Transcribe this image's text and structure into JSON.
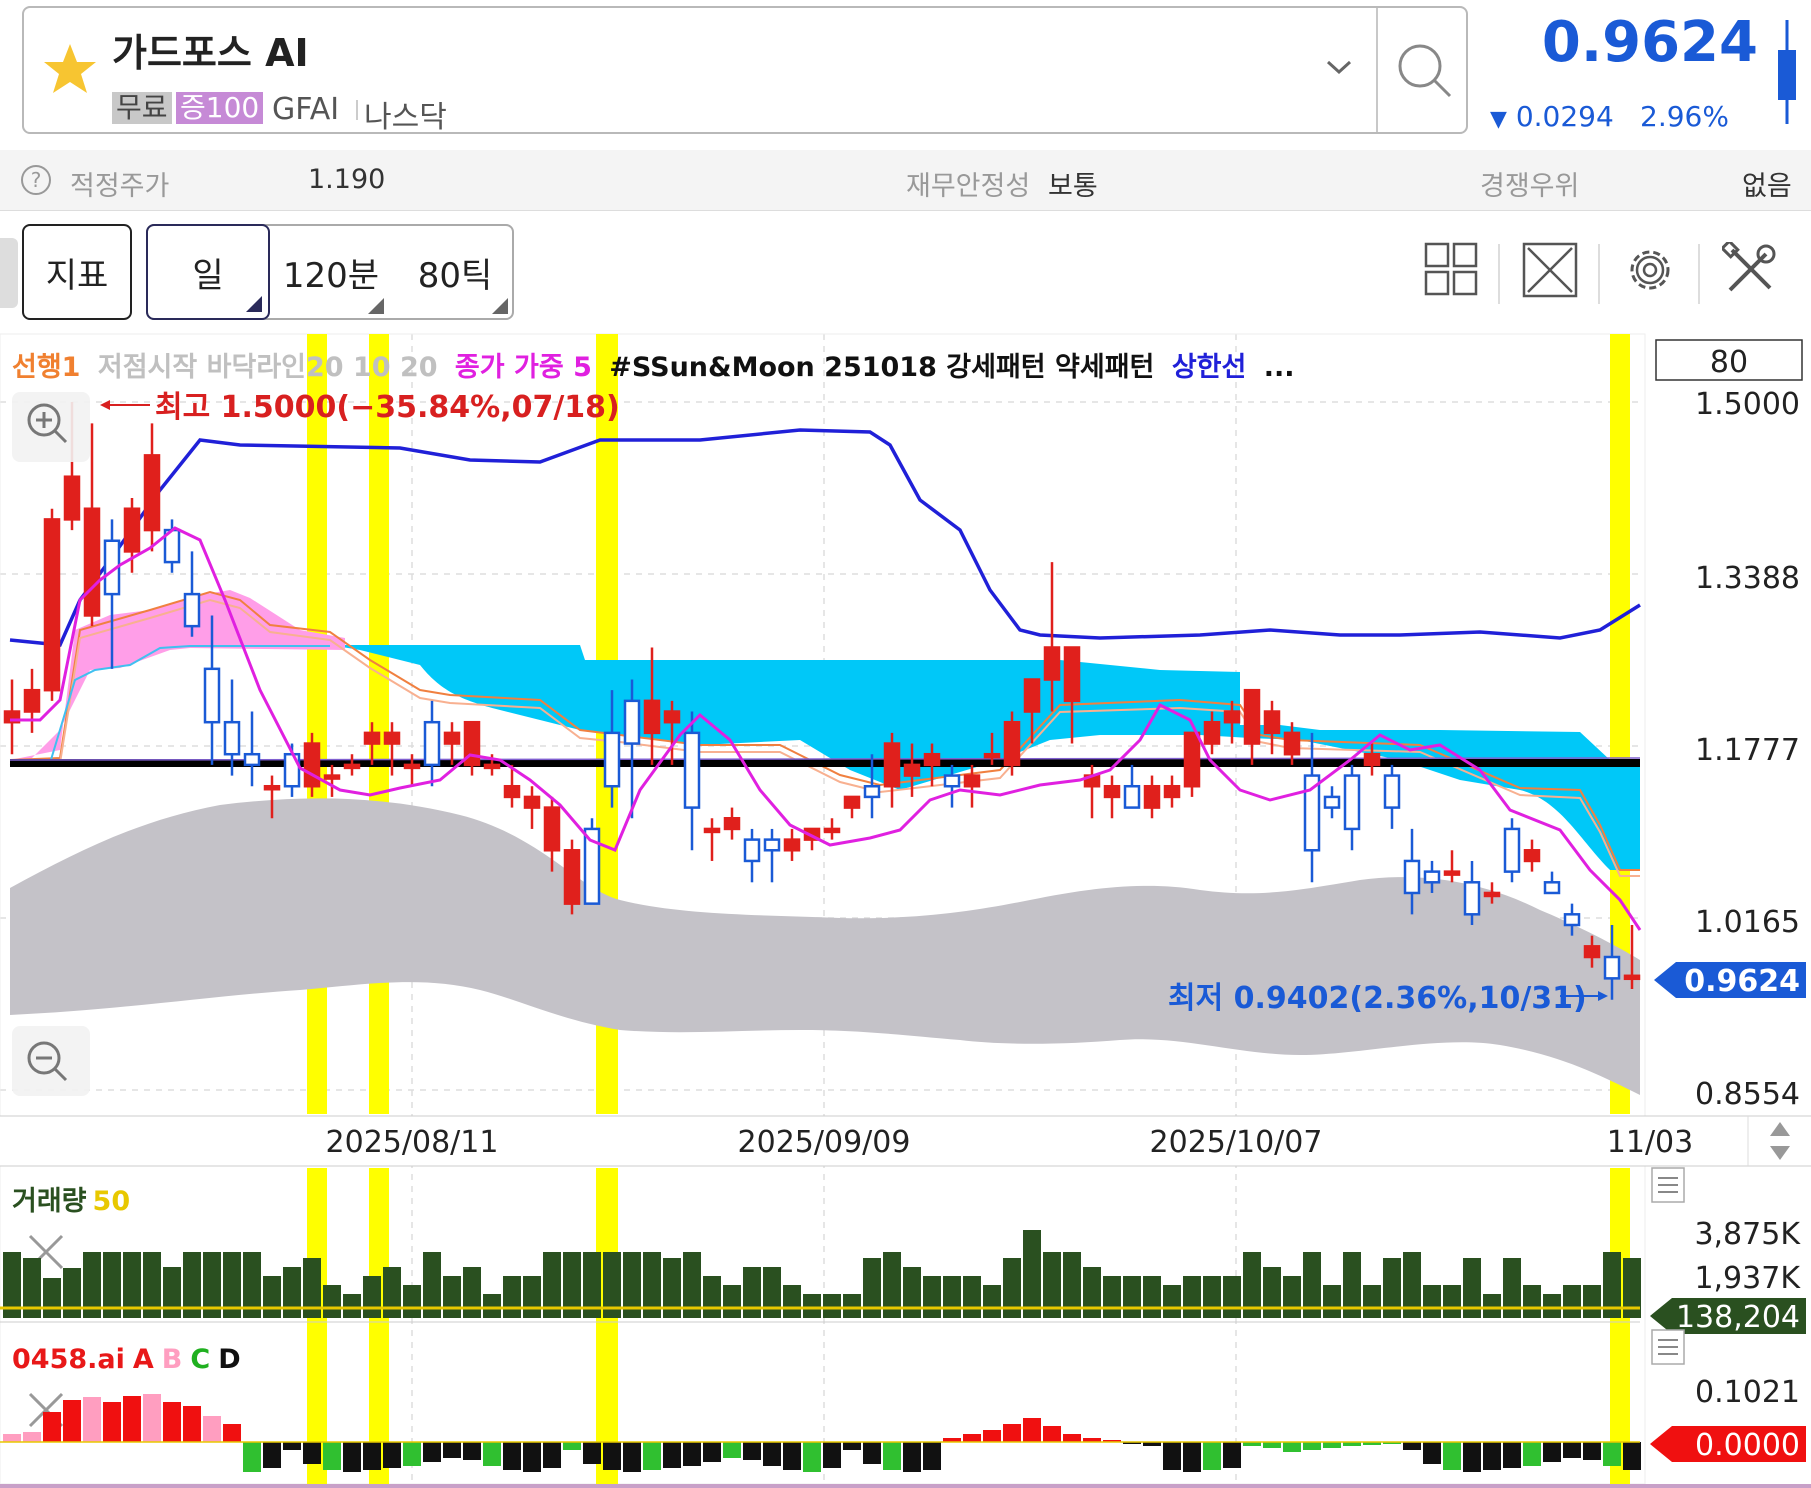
{
  "header": {
    "stock_name": "가드포스 AI",
    "tag_free": "무료",
    "tag_margin": "증100",
    "ticker": "GFAI",
    "market": "나스닥",
    "price": "0.9624",
    "change": "0.0294",
    "change_pct": "2.96%",
    "colors": {
      "down": "#1a5ad6",
      "up": "#e0201c"
    }
  },
  "info": {
    "fair_value_label": "적정주가",
    "fair_value": "1.190",
    "stability_label": "재무안정성",
    "stability_value": "보통",
    "competitive_label": "경쟁우위",
    "competitive_value": "없음"
  },
  "toolbar": {
    "indicator_label": "지표",
    "period_day": "일",
    "period_120": "120분",
    "period_80": "80틱",
    "icons": [
      "grid-layout-icon",
      "expand-icon",
      "gear-icon",
      "tools-icon"
    ]
  },
  "legend": {
    "l1": "선행1",
    "l2": "저점시작 바닥라인20 10 20",
    "l3": "종가 가중 5",
    "l4": "#SSun&Moon 251018 강세패턴 약세패턴",
    "l5": "상한선",
    "l6": "...",
    "count": "80"
  },
  "annotations": {
    "high": "최고 1.5000(−35.84%,07/18)",
    "low": "최저 0.9402(2.36%,10/31)"
  },
  "price_axis": {
    "ticks": [
      "1.5000",
      "1.3388",
      "1.1777",
      "1.0165",
      "0.8554"
    ],
    "current": "0.9624"
  },
  "date_axis": [
    "2025/08/11",
    "2025/09/09",
    "2025/10/07",
    "11/03"
  ],
  "volume_panel": {
    "title": "거래량",
    "period": "50",
    "ticks": [
      "3,875K",
      "1,937K"
    ],
    "current": "138,204"
  },
  "ai_panel": {
    "title": "0458.ai",
    "a": "A",
    "b": "B",
    "c": "C",
    "d": "D",
    "tick": "0.1021",
    "current": "0.0000"
  },
  "chart_data": {
    "type": "candlestick",
    "ylim": [
      0.8554,
      1.5
    ],
    "candles": [
      {
        "o": 1.2,
        "h": 1.24,
        "l": 1.17,
        "c": 1.21
      },
      {
        "o": 1.21,
        "h": 1.25,
        "l": 1.19,
        "c": 1.23
      },
      {
        "o": 1.23,
        "h": 1.4,
        "l": 1.22,
        "c": 1.39
      },
      {
        "o": 1.39,
        "h": 1.5,
        "l": 1.38,
        "c": 1.43
      },
      {
        "o": 1.3,
        "h": 1.48,
        "l": 1.29,
        "c": 1.4
      },
      {
        "o": 1.37,
        "h": 1.39,
        "l": 1.25,
        "c": 1.32
      },
      {
        "o": 1.36,
        "h": 1.41,
        "l": 1.34,
        "c": 1.4
      },
      {
        "o": 1.38,
        "h": 1.48,
        "l": 1.36,
        "c": 1.45
      },
      {
        "o": 1.38,
        "h": 1.39,
        "l": 1.34,
        "c": 1.35
      },
      {
        "o": 1.32,
        "h": 1.36,
        "l": 1.28,
        "c": 1.29
      },
      {
        "o": 1.25,
        "h": 1.3,
        "l": 1.16,
        "c": 1.2
      },
      {
        "o": 1.2,
        "h": 1.24,
        "l": 1.15,
        "c": 1.17
      },
      {
        "o": 1.17,
        "h": 1.21,
        "l": 1.14,
        "c": 1.16
      },
      {
        "o": 1.14,
        "h": 1.15,
        "l": 1.11,
        "c": 1.14
      },
      {
        "o": 1.17,
        "h": 1.18,
        "l": 1.13,
        "c": 1.14
      },
      {
        "o": 1.14,
        "h": 1.19,
        "l": 1.13,
        "c": 1.18
      },
      {
        "o": 1.15,
        "h": 1.16,
        "l": 1.13,
        "c": 1.15
      },
      {
        "o": 1.16,
        "h": 1.17,
        "l": 1.15,
        "c": 1.16
      },
      {
        "o": 1.18,
        "h": 1.2,
        "l": 1.16,
        "c": 1.19
      },
      {
        "o": 1.18,
        "h": 1.2,
        "l": 1.15,
        "c": 1.19
      },
      {
        "o": 1.16,
        "h": 1.17,
        "l": 1.14,
        "c": 1.16
      },
      {
        "o": 1.2,
        "h": 1.22,
        "l": 1.14,
        "c": 1.16
      },
      {
        "o": 1.18,
        "h": 1.2,
        "l": 1.16,
        "c": 1.19
      },
      {
        "o": 1.16,
        "h": 1.2,
        "l": 1.15,
        "c": 1.2
      },
      {
        "o": 1.16,
        "h": 1.17,
        "l": 1.15,
        "c": 1.16
      },
      {
        "o": 1.13,
        "h": 1.16,
        "l": 1.12,
        "c": 1.14
      },
      {
        "o": 1.12,
        "h": 1.14,
        "l": 1.1,
        "c": 1.13
      },
      {
        "o": 1.08,
        "h": 1.13,
        "l": 1.06,
        "c": 1.12
      },
      {
        "o": 1.03,
        "h": 1.09,
        "l": 1.02,
        "c": 1.08
      },
      {
        "o": 1.1,
        "h": 1.11,
        "l": 1.03,
        "c": 1.03
      },
      {
        "o": 1.19,
        "h": 1.23,
        "l": 1.12,
        "c": 1.14
      },
      {
        "o": 1.22,
        "h": 1.24,
        "l": 1.11,
        "c": 1.18
      },
      {
        "o": 1.19,
        "h": 1.27,
        "l": 1.16,
        "c": 1.22
      },
      {
        "o": 1.2,
        "h": 1.22,
        "l": 1.16,
        "c": 1.21
      },
      {
        "o": 1.19,
        "h": 1.21,
        "l": 1.08,
        "c": 1.12
      },
      {
        "o": 1.1,
        "h": 1.11,
        "l": 1.07,
        "c": 1.1
      },
      {
        "o": 1.1,
        "h": 1.12,
        "l": 1.09,
        "c": 1.11
      },
      {
        "o": 1.09,
        "h": 1.1,
        "l": 1.05,
        "c": 1.07
      },
      {
        "o": 1.09,
        "h": 1.1,
        "l": 1.05,
        "c": 1.08
      },
      {
        "o": 1.08,
        "h": 1.1,
        "l": 1.07,
        "c": 1.09
      },
      {
        "o": 1.09,
        "h": 1.1,
        "l": 1.08,
        "c": 1.1
      },
      {
        "o": 1.1,
        "h": 1.11,
        "l": 1.09,
        "c": 1.1
      },
      {
        "o": 1.12,
        "h": 1.13,
        "l": 1.11,
        "c": 1.13
      },
      {
        "o": 1.14,
        "h": 1.17,
        "l": 1.11,
        "c": 1.13
      },
      {
        "o": 1.14,
        "h": 1.19,
        "l": 1.12,
        "c": 1.18
      },
      {
        "o": 1.15,
        "h": 1.18,
        "l": 1.13,
        "c": 1.16
      },
      {
        "o": 1.16,
        "h": 1.18,
        "l": 1.14,
        "c": 1.17
      },
      {
        "o": 1.15,
        "h": 1.16,
        "l": 1.12,
        "c": 1.14
      },
      {
        "o": 1.14,
        "h": 1.16,
        "l": 1.12,
        "c": 1.15
      },
      {
        "o": 1.17,
        "h": 1.19,
        "l": 1.16,
        "c": 1.17
      },
      {
        "o": 1.16,
        "h": 1.21,
        "l": 1.15,
        "c": 1.2
      },
      {
        "o": 1.21,
        "h": 1.24,
        "l": 1.18,
        "c": 1.24
      },
      {
        "o": 1.24,
        "h": 1.35,
        "l": 1.21,
        "c": 1.27
      },
      {
        "o": 1.22,
        "h": 1.27,
        "l": 1.18,
        "c": 1.27
      },
      {
        "o": 1.14,
        "h": 1.16,
        "l": 1.11,
        "c": 1.15
      },
      {
        "o": 1.13,
        "h": 1.15,
        "l": 1.11,
        "c": 1.14
      },
      {
        "o": 1.14,
        "h": 1.16,
        "l": 1.12,
        "c": 1.12
      },
      {
        "o": 1.12,
        "h": 1.15,
        "l": 1.11,
        "c": 1.14
      },
      {
        "o": 1.13,
        "h": 1.15,
        "l": 1.12,
        "c": 1.14
      },
      {
        "o": 1.14,
        "h": 1.17,
        "l": 1.13,
        "c": 1.19
      },
      {
        "o": 1.18,
        "h": 1.21,
        "l": 1.17,
        "c": 1.2
      },
      {
        "o": 1.2,
        "h": 1.22,
        "l": 1.18,
        "c": 1.21
      },
      {
        "o": 1.18,
        "h": 1.23,
        "l": 1.16,
        "c": 1.23
      },
      {
        "o": 1.19,
        "h": 1.22,
        "l": 1.17,
        "c": 1.21
      },
      {
        "o": 1.17,
        "h": 1.2,
        "l": 1.16,
        "c": 1.19
      },
      {
        "o": 1.15,
        "h": 1.19,
        "l": 1.05,
        "c": 1.08
      },
      {
        "o": 1.13,
        "h": 1.14,
        "l": 1.11,
        "c": 1.12
      },
      {
        "o": 1.15,
        "h": 1.16,
        "l": 1.08,
        "c": 1.1
      },
      {
        "o": 1.16,
        "h": 1.18,
        "l": 1.15,
        "c": 1.17
      },
      {
        "o": 1.15,
        "h": 1.16,
        "l": 1.1,
        "c": 1.12
      },
      {
        "o": 1.07,
        "h": 1.1,
        "l": 1.02,
        "c": 1.04
      },
      {
        "o": 1.06,
        "h": 1.07,
        "l": 1.04,
        "c": 1.05
      },
      {
        "o": 1.06,
        "h": 1.08,
        "l": 1.05,
        "c": 1.06
      },
      {
        "o": 1.05,
        "h": 1.07,
        "l": 1.01,
        "c": 1.02
      },
      {
        "o": 1.04,
        "h": 1.05,
        "l": 1.03,
        "c": 1.04
      },
      {
        "o": 1.1,
        "h": 1.11,
        "l": 1.05,
        "c": 1.06
      },
      {
        "o": 1.07,
        "h": 1.09,
        "l": 1.06,
        "c": 1.08
      },
      {
        "o": 1.05,
        "h": 1.06,
        "l": 1.04,
        "c": 1.04
      },
      {
        "o": 1.02,
        "h": 1.03,
        "l": 1.0,
        "c": 1.01
      },
      {
        "o": 0.98,
        "h": 1.0,
        "l": 0.97,
        "c": 0.99
      },
      {
        "o": 0.98,
        "h": 1.01,
        "l": 0.94,
        "c": 0.96
      },
      {
        "o": 0.96,
        "h": 1.01,
        "l": 0.95,
        "c": 0.9624
      }
    ]
  }
}
